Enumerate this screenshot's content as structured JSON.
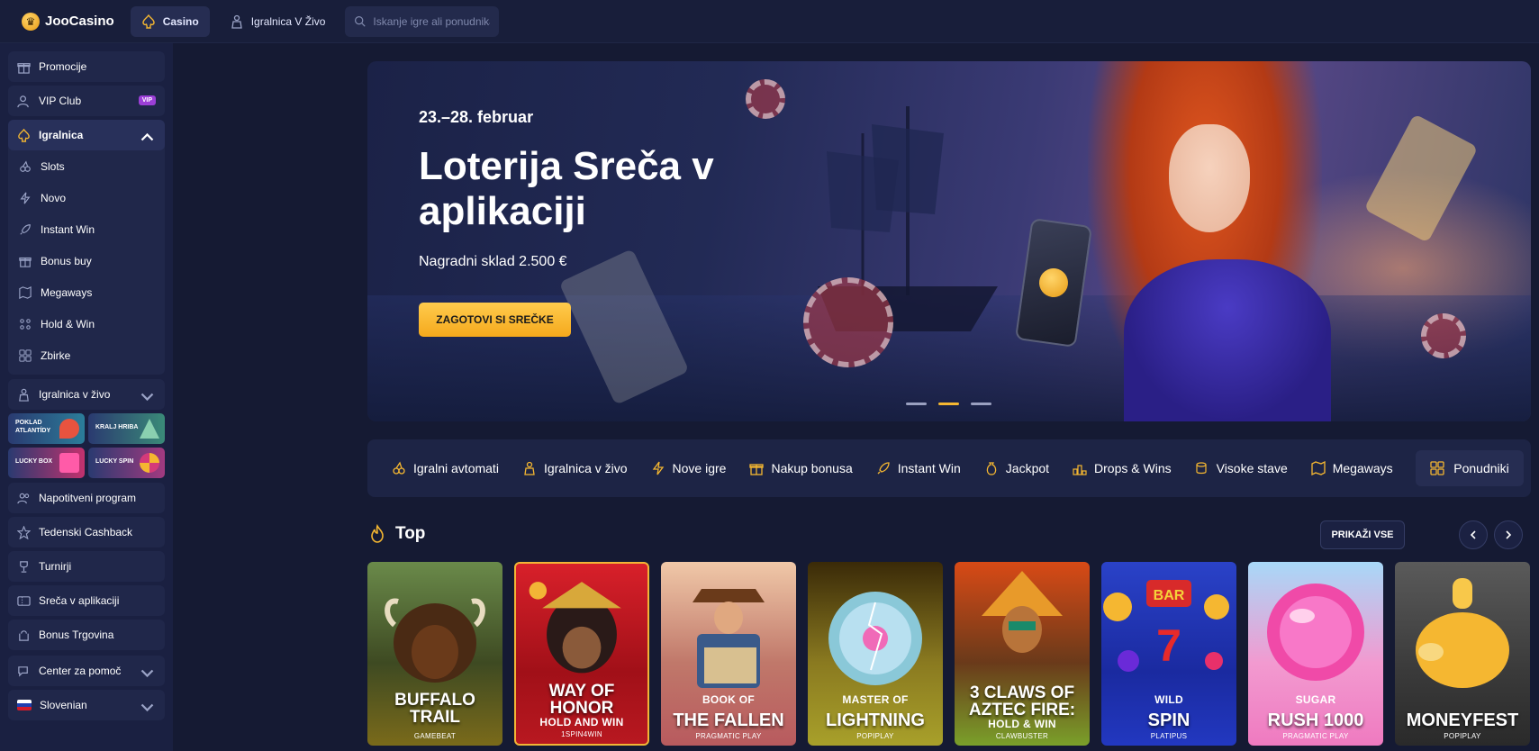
{
  "header": {
    "logo_text": "JooCasino",
    "nav": [
      {
        "label": "Casino",
        "active": true
      },
      {
        "label": "Igralnica V Živo",
        "active": false
      }
    ],
    "search_placeholder": "Iskanje igre ali ponudnika"
  },
  "sidebar": {
    "top_items": [
      {
        "label": "Promocije",
        "icon": "gift-icon"
      },
      {
        "label": "VIP Club",
        "icon": "user-icon",
        "badge": "VIP"
      }
    ],
    "casino_group": {
      "label": "Igralnica",
      "expanded": true,
      "items": [
        {
          "label": "Slots",
          "icon": "cherry-icon"
        },
        {
          "label": "Novo",
          "icon": "lightning-icon"
        },
        {
          "label": "Instant Win",
          "icon": "rocket-icon"
        },
        {
          "label": "Bonus buy",
          "icon": "gift-icon"
        },
        {
          "label": "Megaways",
          "icon": "map-icon"
        },
        {
          "label": "Hold & Win",
          "icon": "grid-dots-icon"
        },
        {
          "label": "Zbirke",
          "icon": "grid-icon"
        }
      ]
    },
    "live_group": {
      "label": "Igralnica v živo",
      "expanded": false
    },
    "promo_tiles": [
      {
        "label": "POKLAD ATLANTÍDY"
      },
      {
        "label": "KRALJ HRIBA"
      },
      {
        "label": "LUCKY BOX"
      },
      {
        "label": "LUCKY SPIN"
      }
    ],
    "bottom_items": [
      {
        "label": "Napotitveni program",
        "icon": "users-icon"
      },
      {
        "label": "Tedenski Cashback",
        "icon": "star-icon"
      },
      {
        "label": "Turnirji",
        "icon": "trophy-icon"
      },
      {
        "label": "Sreča v aplikaciji",
        "icon": "ticket-icon"
      },
      {
        "label": "Bonus Trgovina",
        "icon": "shop-icon"
      }
    ],
    "help_label": "Center za pomoč",
    "language_label": "Slovenian"
  },
  "hero": {
    "date": "23.–28. februar",
    "title": "Loterija Sreča v aplikaciji",
    "subtitle": "Nagradni sklad 2.500 €",
    "cta": "ZAGOTOVI SI SREČKE",
    "slides": 3,
    "active_slide": 2
  },
  "categories": [
    {
      "label": "Igralni avtomati",
      "icon": "cherry-icon"
    },
    {
      "label": "Igralnica v živo",
      "icon": "dealer-icon"
    },
    {
      "label": "Nove igre",
      "icon": "lightning-icon"
    },
    {
      "label": "Nakup bonusa",
      "icon": "gift-icon"
    },
    {
      "label": "Instant Win",
      "icon": "rocket-icon"
    },
    {
      "label": "Jackpot",
      "icon": "money-bag-icon"
    },
    {
      "label": "Drops & Wins",
      "icon": "podium-icon"
    },
    {
      "label": "Visoke stave",
      "icon": "coins-icon"
    },
    {
      "label": "Megaways",
      "icon": "map-icon"
    }
  ],
  "providers_label": "Ponudniki",
  "top_section": {
    "title": "Top",
    "show_all": "PRIKAŽI VSE",
    "games": [
      {
        "name": "BUFFALO TRAIL",
        "provider": "GAMEBEAT"
      },
      {
        "name": "WAY OF HONOR",
        "subtitle": "HOLD AND WIN",
        "provider": "1SPIN4WIN"
      },
      {
        "name": "THE FALLEN",
        "prefix": "BOOK OF",
        "provider": "PRAGMATIC PLAY"
      },
      {
        "name": "LIGHTNING",
        "prefix": "MASTER OF",
        "provider": "POPIPLAY"
      },
      {
        "name": "3 CLAWS OF AZTEC FIRE:",
        "subtitle": "HOLD & WIN",
        "provider": "CLAWBUSTER"
      },
      {
        "name": "SPIN",
        "prefix": "WILD",
        "provider": "PLATIPUS"
      },
      {
        "name": "RUSH 1000",
        "prefix": "SUGAR",
        "provider": "PRAGMATIC PLAY"
      },
      {
        "name": "MONEYFEST",
        "provider": "POPIPLAY"
      }
    ]
  }
}
